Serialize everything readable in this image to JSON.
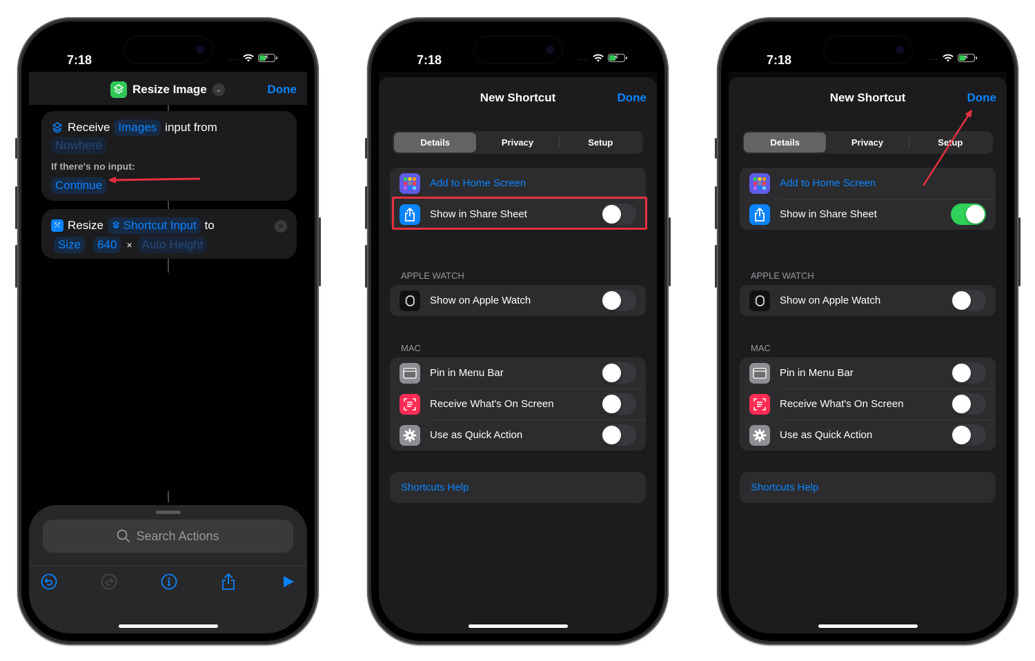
{
  "status_bar": {
    "time": "7:18",
    "signal": "....",
    "wifi_icon": "wifi-icon",
    "battery_icon": "battery-charging-icon"
  },
  "colors": {
    "accent": "#0a84ff",
    "toggle_on": "#30d158",
    "annotation": "#e8303e",
    "app_icon": "#30c759"
  },
  "editor": {
    "title": "Resize Image",
    "done_label": "Done",
    "actions": [
      {
        "verb": "Receive",
        "type_token": "Images",
        "text": "input from",
        "source_token": "Nowhere",
        "no_input_label": "If there's no input:",
        "no_input_value": "Continue"
      },
      {
        "verb": "Resize",
        "input_token": "Shortcut Input",
        "text": "to",
        "mode_token": "Size",
        "width_token": "640",
        "times": "×",
        "height_token": "Auto Height"
      }
    ],
    "search_placeholder": "Search Actions",
    "toolbar": [
      "undo",
      "redo",
      "info",
      "share",
      "run"
    ]
  },
  "sheet": {
    "title": "New Shortcut",
    "done_label": "Done",
    "tabs": [
      {
        "label": "Details",
        "active": true
      },
      {
        "label": "Privacy",
        "active": false
      },
      {
        "label": "Setup",
        "active": false
      }
    ],
    "add_home": "Add to Home Screen",
    "share_sheet": "Show in Share Sheet",
    "watch_header": "APPLE WATCH",
    "watch": "Show on Apple Watch",
    "mac_header": "MAC",
    "mac_items": [
      "Pin in Menu Bar",
      "Receive What's On Screen",
      "Use as Quick Action"
    ],
    "help": "Shortcuts Help"
  },
  "screens": [
    {
      "share_sheet_on": false
    },
    {
      "share_sheet_on": true
    }
  ]
}
